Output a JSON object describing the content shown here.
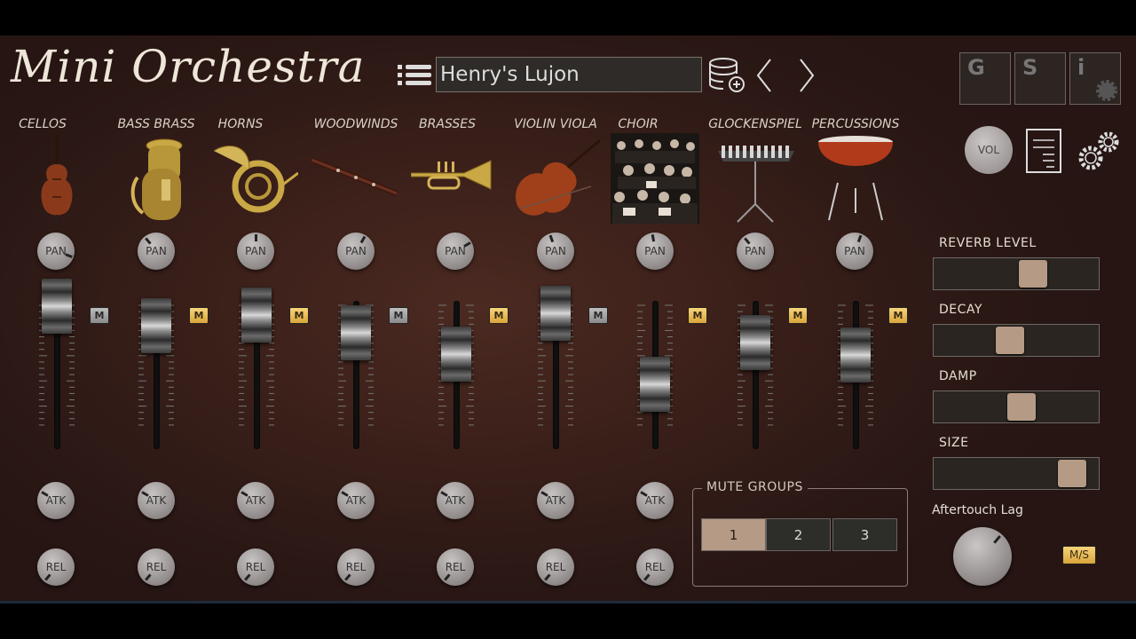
{
  "app": {
    "title": "Mini Orchestra"
  },
  "preset": {
    "name": "Henry's Lujon"
  },
  "top_buttons": {
    "g": "G",
    "s": "S",
    "i": "i"
  },
  "vol": {
    "label": "VOL"
  },
  "knob_labels": {
    "pan": "PAN",
    "atk": "ATK",
    "rel": "REL"
  },
  "channels": [
    {
      "name": "CELLOS",
      "fader": 1.0,
      "mute": false,
      "has_env": true
    },
    {
      "name": "BASS BRASS",
      "fader": 0.82,
      "mute": true,
      "has_env": true
    },
    {
      "name": "HORNS",
      "fader": 0.92,
      "mute": true,
      "has_env": true
    },
    {
      "name": "WOODWINDS",
      "fader": 0.75,
      "mute": false,
      "has_env": true
    },
    {
      "name": "BRASSES",
      "fader": 0.55,
      "mute": true,
      "has_env": true
    },
    {
      "name": "VIOLIN VIOLA",
      "fader": 0.93,
      "mute": false,
      "has_env": true
    },
    {
      "name": "CHOIR",
      "fader": 0.27,
      "mute": true,
      "has_env": true
    },
    {
      "name": "GLOCKENSPIEL",
      "fader": 0.66,
      "mute": true,
      "has_env": false
    },
    {
      "name": "PERCUSSIONS",
      "fader": 0.54,
      "mute": true,
      "has_env": false
    }
  ],
  "mute_label": "M",
  "mute_groups": {
    "label": "MUTE GROUPS",
    "options": [
      "1",
      "2",
      "3"
    ],
    "selected": "1"
  },
  "reverb": {
    "reverb_level": {
      "label": "REVERB LEVEL",
      "value": 0.62
    },
    "decay": {
      "label": "DECAY",
      "value": 0.45
    },
    "damp": {
      "label": "DAMP",
      "value": 0.53
    },
    "size": {
      "label": "SIZE",
      "value": 0.91
    }
  },
  "aftertouch": {
    "label": "Aftertouch Lag",
    "ms_label": "M/S"
  },
  "colors": {
    "accent": "#b59a86",
    "mute_on": "#e8b84f",
    "panel": "#3a1f19"
  }
}
